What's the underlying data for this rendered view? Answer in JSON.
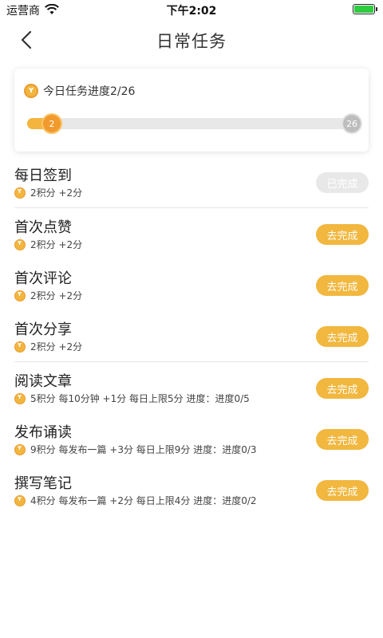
{
  "status": {
    "carrier": "运营商",
    "time": "下午2:02"
  },
  "nav": {
    "title": "日常任务"
  },
  "progress": {
    "label": "今日任务进度2/26",
    "current": "2",
    "total": "26",
    "fraction": 0.0769
  },
  "tasks": [
    {
      "title": "每日签到",
      "meta": "2积分 +2分",
      "button": "已完成",
      "done": true
    },
    {
      "title": "首次点赞",
      "meta": "2积分 +2分",
      "button": "去完成",
      "done": false
    },
    {
      "title": "首次评论",
      "meta": "2积分 +2分",
      "button": "去完成",
      "done": false
    },
    {
      "title": "首次分享",
      "meta": "2积分 +2分",
      "button": "去完成",
      "done": false
    },
    {
      "title": "阅读文章",
      "meta": "5积分 每10分钟 +1分  每日上限5分     进度：进度0/5",
      "button": "去完成",
      "done": false
    },
    {
      "title": "发布诵读",
      "meta": "9积分 每发布一篇 +3分  每日上限9分     进度：进度0/3",
      "button": "去完成",
      "done": false
    },
    {
      "title": "撰写笔记",
      "meta": "4积分 每发布一篇 +2分   每日上限4分     进度：进度0/2",
      "button": "去完成",
      "done": false
    }
  ],
  "colors": {
    "accent": "#f1b73e",
    "done_button": "#e8e8e8"
  }
}
